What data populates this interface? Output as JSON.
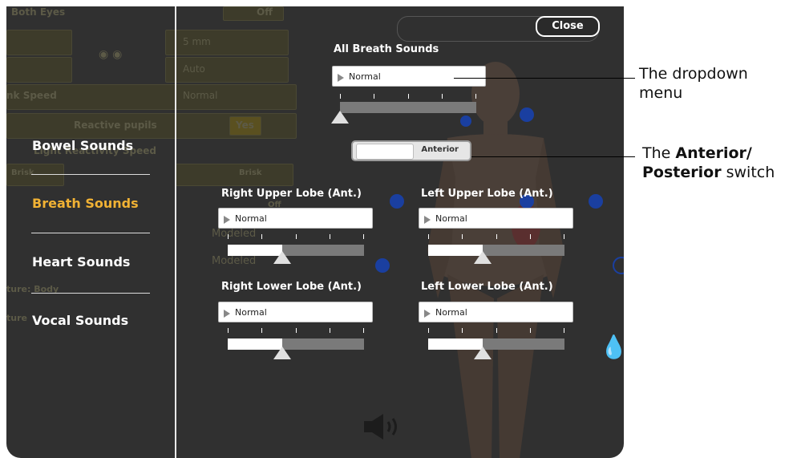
{
  "panel": {
    "close_label": "Close",
    "background_ghost": {
      "both_eyes": "Both Eyes",
      "off_1": "Off",
      "pupil_size": "5 mm",
      "auto": "Auto",
      "blink_speed": "nk Speed",
      "blink_normal": "Normal",
      "reactive_pupils": "Reactive pupils",
      "yes": "Yes",
      "light_reactivity": "Light Reactivity Speed",
      "brisk_left": "Brisk",
      "brisk_right": "Brisk",
      "off_2": "Off",
      "modeled_1": "Modeled",
      "modeled_2": "Modeled",
      "ture_body": "ture: Body",
      "ture": "ture"
    }
  },
  "menu": {
    "items": [
      {
        "label": "Bowel Sounds",
        "active": false
      },
      {
        "label": "Breath Sounds",
        "active": true
      },
      {
        "label": "Heart Sounds",
        "active": false
      },
      {
        "label": "Vocal Sounds",
        "active": false
      }
    ]
  },
  "breath": {
    "all": {
      "title": "All Breath Sounds",
      "value": "Normal",
      "level": 0.0
    },
    "switch_label": "Anterior",
    "right_upper": {
      "title": "Right Upper Lobe (Ant.)",
      "value": "Normal",
      "level": 0.4
    },
    "left_upper": {
      "title": "Left Upper Lobe (Ant.)",
      "value": "Normal",
      "level": 0.4
    },
    "right_lower": {
      "title": "Right Lower Lobe (Ant.)",
      "value": "Normal",
      "level": 0.4
    },
    "left_lower": {
      "title": "Left Lower Lobe (Ant.)",
      "value": "Normal",
      "level": 0.4
    }
  },
  "callouts": {
    "dropdown_line1": "The dropdown",
    "dropdown_line2": "menu",
    "switch_prefix": "The ",
    "switch_bold1": "Anterior/",
    "switch_bold2": "Posterior",
    "switch_suffix": " switch"
  },
  "icons": {
    "speaker": "speaker-icon",
    "eyes": "eye-icon",
    "drop": "drop-icon"
  },
  "colors": {
    "active_menu": "#f1b234",
    "panel_bg": "#303030",
    "dot_blue": "#1a3fa0"
  }
}
